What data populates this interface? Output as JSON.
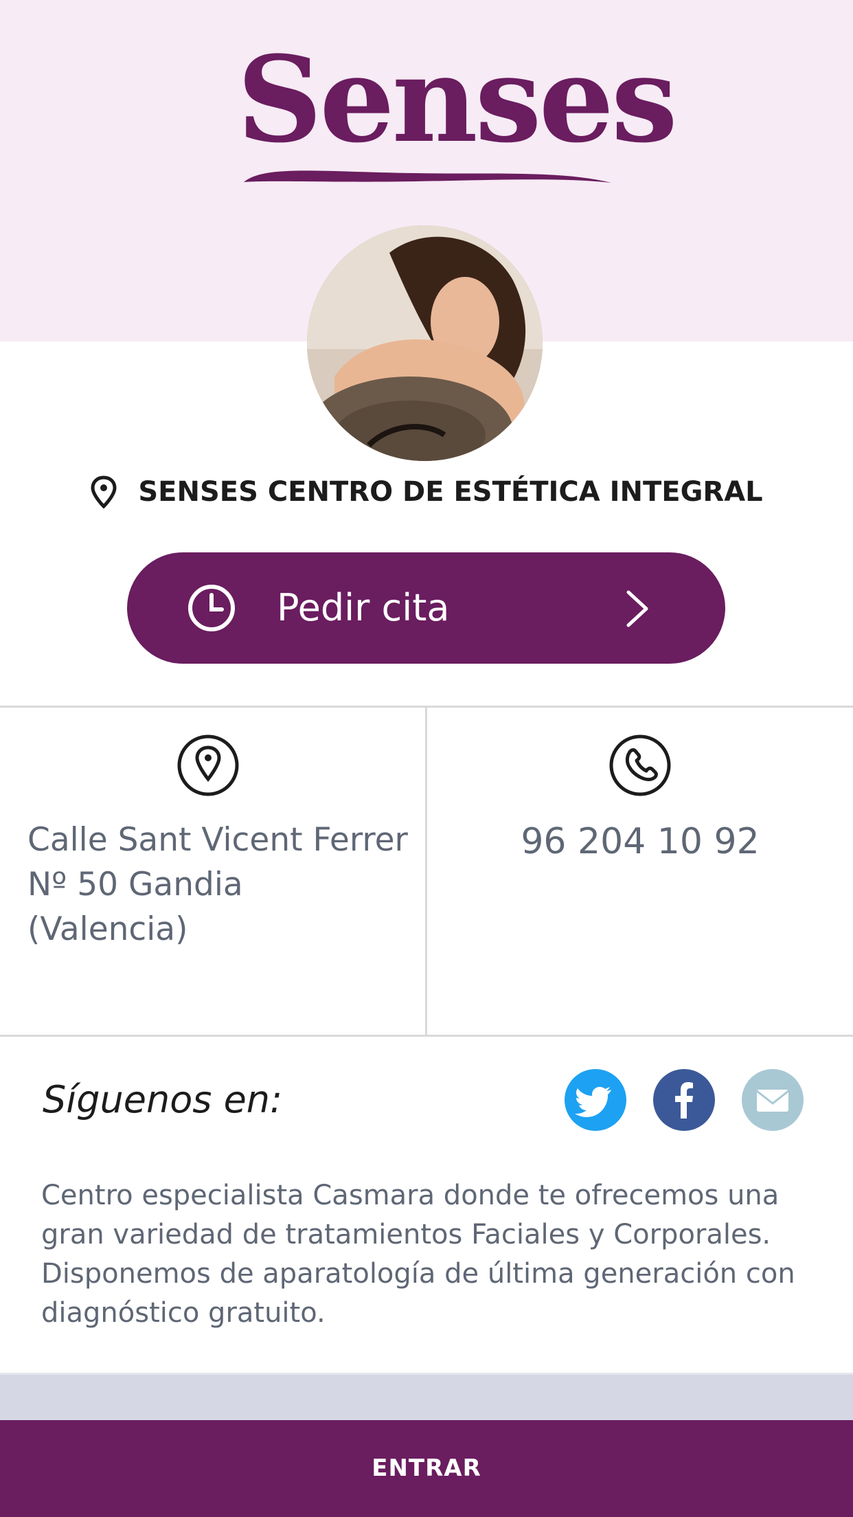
{
  "header": {
    "logo_text": "Senses",
    "background_color": "#f7ebf5",
    "brand_color": "#6a1d5f"
  },
  "profile": {
    "avatar_alt": "salon-photo",
    "business_name": "SENSES CENTRO DE ESTÉTICA INTEGRAL",
    "location_icon": "map-pin-icon"
  },
  "cta": {
    "label": "Pedir cita",
    "icon": "clock-icon",
    "trailing_icon": "chevron-right-icon"
  },
  "contact": {
    "address_line1": "Calle Sant Vicent Ferrer",
    "address_line2": "Nº 50 Gandia (Valencia)",
    "address_icon": "map-pin-circle-icon",
    "phone": "96 204 10 92",
    "phone_icon": "phone-circle-icon"
  },
  "social": {
    "label": "Síguenos en:",
    "items": [
      {
        "name": "twitter",
        "icon": "twitter-icon",
        "color": "#1da1f2"
      },
      {
        "name": "facebook",
        "icon": "facebook-icon",
        "color": "#3b5998"
      },
      {
        "name": "email",
        "icon": "mail-icon",
        "color": "#a8c8d4"
      }
    ]
  },
  "description": "Centro especialista Casmara donde te ofrecemos una gran variedad de tratamientos Faciales y Corporales. Disponemos de aparatología de última generación con diagnóstico gratuito.",
  "footer": {
    "enter_label": "ENTRAR"
  }
}
